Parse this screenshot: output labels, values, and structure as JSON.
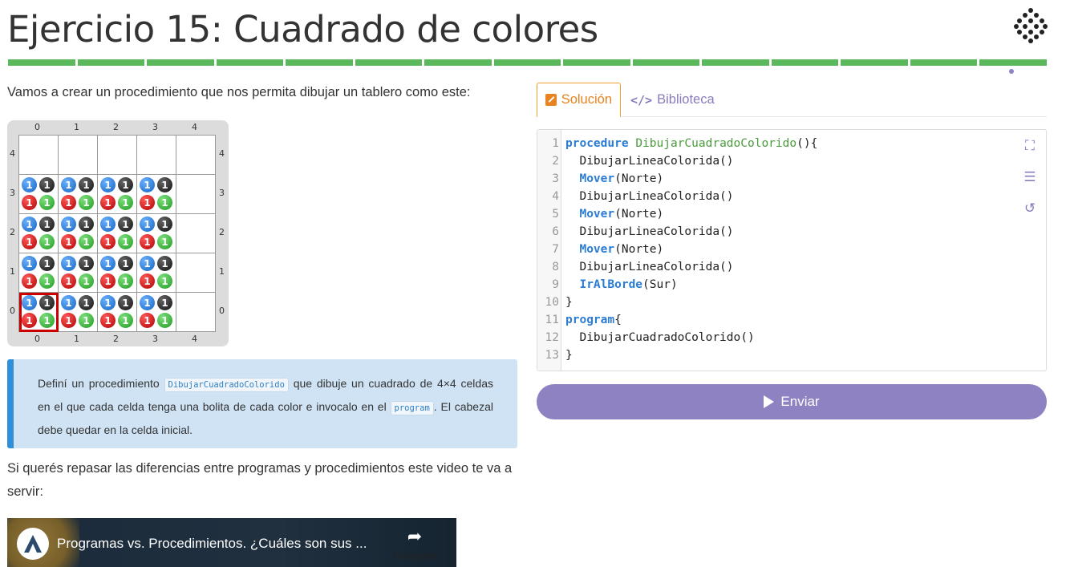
{
  "header": {
    "title": "Ejercicio 15: Cuadrado de colores",
    "logo_icon": "mumuki-logo-icon",
    "progress_segments": 15,
    "progress_color": "#5cb85c"
  },
  "intro": "Vamos a crear un procedimiento que nos permita dibujar un tablero como este:",
  "board": {
    "columns": [
      "0",
      "1",
      "2",
      "3",
      "4"
    ],
    "rows": [
      "4",
      "3",
      "2",
      "1",
      "0"
    ],
    "ball_count": "1",
    "ball_colors": {
      "blue": "#1565c0",
      "black": "#111111",
      "red": "#b00000",
      "green": "#1f9a1f"
    }
  },
  "task": {
    "p1": "Definí un procedimiento ",
    "code1": "DibujarCuadradoColorido",
    "p2": " que dibuje un cuadrado de 4×4 celdas en el que cada celda tenga una bolita de cada color e invocalo en el ",
    "code2": "program",
    "p3": ". El cabezal debe quedar en la celda inicial."
  },
  "review_text": "Si querés repasar las diferencias entre programas y procedimientos este video te va a servir:",
  "video": {
    "title": "Programas vs. Procedimientos. ¿Cuáles son sus ...",
    "share_label": "Compartir"
  },
  "tabs": {
    "solution_label": "Solución",
    "library_label": "Biblioteca"
  },
  "editor": {
    "lines": [
      [
        [
          "kw",
          "procedure "
        ],
        [
          "fn",
          "DibujarCuadradoColorido"
        ],
        [
          "tx",
          "(){"
        ]
      ],
      [
        [
          "tx",
          "  DibujarLineaColorida()"
        ]
      ],
      [
        [
          "tx",
          "  "
        ],
        [
          "pr",
          "Mover"
        ],
        [
          "tx",
          "(Norte)"
        ]
      ],
      [
        [
          "tx",
          "  DibujarLineaColorida()"
        ]
      ],
      [
        [
          "tx",
          "  "
        ],
        [
          "pr",
          "Mover"
        ],
        [
          "tx",
          "(Norte)"
        ]
      ],
      [
        [
          "tx",
          "  DibujarLineaColorida()"
        ]
      ],
      [
        [
          "tx",
          "  "
        ],
        [
          "pr",
          "Mover"
        ],
        [
          "tx",
          "(Norte)"
        ]
      ],
      [
        [
          "tx",
          "  DibujarLineaColorida()"
        ]
      ],
      [
        [
          "tx",
          "  "
        ],
        [
          "pr",
          "IrAlBorde"
        ],
        [
          "tx",
          "(Sur)"
        ]
      ],
      [
        [
          "tx",
          "}"
        ]
      ],
      [
        [
          "kw",
          "program"
        ],
        [
          "tx",
          "{"
        ]
      ],
      [
        [
          "tx",
          "  DibujarCuadradoColorido()"
        ]
      ],
      [
        [
          "tx",
          "}"
        ]
      ]
    ]
  },
  "submit": {
    "label": "Enviar"
  }
}
